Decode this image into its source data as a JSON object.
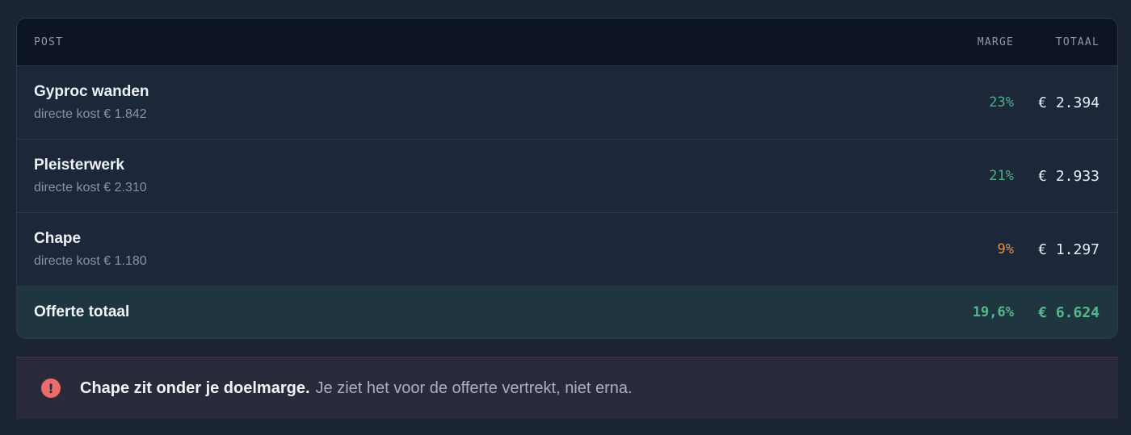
{
  "table": {
    "headers": {
      "post": "POST",
      "marge": "MARGE",
      "totaal": "TOTAAL"
    },
    "rows": [
      {
        "name": "Gyproc wanden",
        "sub": "directe kost € 1.842",
        "marge": "23%",
        "marge_status": "good",
        "totaal": "€ 2.394"
      },
      {
        "name": "Pleisterwerk",
        "sub": "directe kost € 2.310",
        "marge": "21%",
        "marge_status": "good",
        "totaal": "€ 2.933"
      },
      {
        "name": "Chape",
        "sub": "directe kost € 1.180",
        "marge": "9%",
        "marge_status": "warn",
        "totaal": "€ 1.297"
      }
    ],
    "total": {
      "label": "Offerte totaal",
      "marge": "19,6%",
      "totaal": "€ 6.624"
    }
  },
  "alert": {
    "icon": "exclamation-icon",
    "icon_glyph": "!",
    "strong": "Chape zit onder je doelmarge.",
    "text": "Je ziet het voor de offerte vertrekt, niet erna."
  },
  "colors": {
    "good": "#4fae85",
    "warn": "#e0904a",
    "alert_icon": "#ec6b6b"
  }
}
